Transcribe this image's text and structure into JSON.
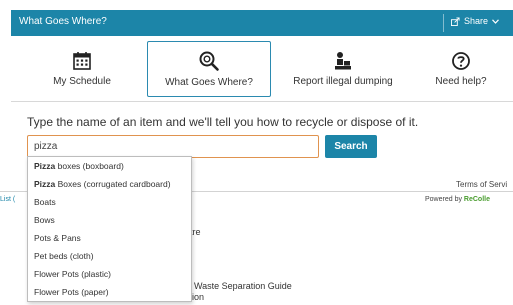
{
  "header": {
    "title": "What Goes Where?",
    "share_label": "Share",
    "share_icon": "share-icon",
    "bg_color": "#1c85a8"
  },
  "nav": [
    {
      "label": "My Schedule",
      "icon": "calendar-icon",
      "active": false
    },
    {
      "label": "What Goes Where?",
      "icon": "search-recycle-icon",
      "active": true
    },
    {
      "label": "Report illegal dumping",
      "icon": "dumping-icon",
      "active": false
    },
    {
      "label": "Need help?",
      "icon": "help-icon",
      "active": false
    }
  ],
  "search": {
    "prompt": "Type the name of an item and we'll tell you how to recycle or dispose of it.",
    "value": "pizza",
    "button_label": "Search",
    "accent_color": "#e0934f"
  },
  "suggestions": [
    {
      "bold": "Pizza",
      "rest": " boxes (boxboard)"
    },
    {
      "bold": "Pizza",
      "rest": " Boxes (corrugated cardboard)"
    },
    {
      "bold": "",
      "rest": "Boats"
    },
    {
      "bold": "",
      "rest": "Bows"
    },
    {
      "bold": "",
      "rest": "Pots & Pans"
    },
    {
      "bold": "",
      "rest": "Pet beds (cloth)"
    },
    {
      "bold": "",
      "rest": "Flower Pots (plastic)"
    },
    {
      "bold": "",
      "rest": "Flower Pots (paper)"
    }
  ],
  "footer": {
    "terms": "Terms of Servi",
    "list_link": "List (",
    "powered_by": "Powered by",
    "brand": "ReColle"
  },
  "background_links": [
    {
      "text": "entre"
    },
    {
      "text": "r & Waste Separation Guide"
    },
    {
      "text": "ection"
    }
  ]
}
